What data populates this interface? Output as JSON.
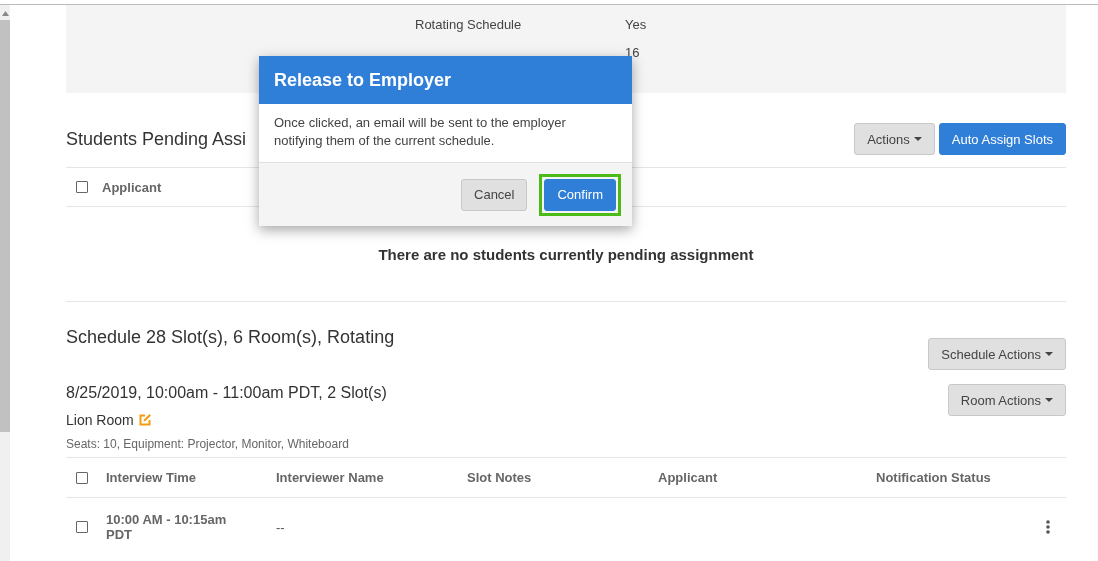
{
  "summary": [
    {
      "label": "Rotating Schedule",
      "value": "Yes"
    },
    {
      "value": "16"
    }
  ],
  "pending": {
    "title": "Students Pending Assi",
    "buttons": [
      {
        "label": "Actions",
        "kind": "dropdown"
      },
      {
        "label": "Auto Assign Slots",
        "kind": "primary"
      }
    ],
    "columns": [
      {
        "label": "Applicant",
        "checked": false
      }
    ],
    "empty": "There are no students currently pending assignment"
  },
  "schedule": {
    "title": "Schedule 28 Slot(s), 6 Room(s), Rotating",
    "actions": "Schedule Actions",
    "block": {
      "title": "8/25/2019, 10:00am - 11:00am PDT, 2 Slot(s)",
      "actions": "Room Actions",
      "room": "Lion Room",
      "details": "Seats: 10, Equipment: Projector, Monitor, Whiteboard",
      "header_checked": false,
      "columns": [
        "Interview Time",
        "Interviewer Name",
        "Slot Notes",
        "Applicant",
        "Notification Status"
      ],
      "rows": [
        {
          "checked": false,
          "time": "10:00 AM - 10:15am PDT",
          "interviewer": "--"
        }
      ]
    }
  },
  "modal": {
    "title": "Release to Employer",
    "message": "Once clicked, an email will be sent to the employer notifying them of the current schedule.",
    "buttons": [
      {
        "label": "Cancel",
        "kind": "default",
        "focused": false
      },
      {
        "label": "Confirm",
        "kind": "primary",
        "focused": true
      }
    ]
  }
}
